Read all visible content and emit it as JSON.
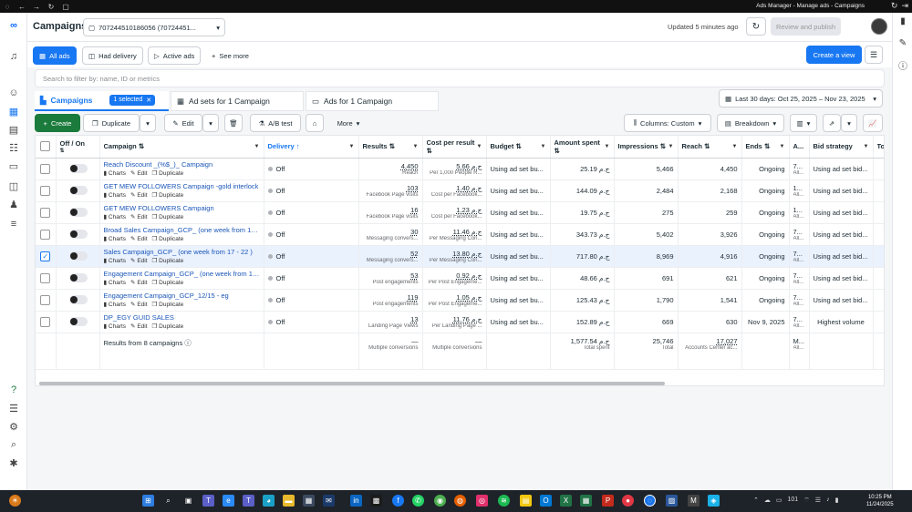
{
  "window": {
    "title": "Ads Manager - Manage ads - Campaigns"
  },
  "header": {
    "page_title": "Campaigns",
    "account": "707244510186056 (70724451...",
    "updated": "Updated 5 minutes ago",
    "review_label": "Review and publish"
  },
  "filters": {
    "all_ads": "All ads",
    "had_delivery": "Had delivery",
    "active_ads": "Active ads",
    "see_more": "See more",
    "create_view": "Create a view"
  },
  "search": {
    "placeholder": "Search to filter by: name, ID or metrics"
  },
  "tabs": {
    "campaigns": "Campaigns",
    "selected": "1 selected",
    "adsets": "Ad sets for 1 Campaign",
    "ads": "Ads for 1 Campaign"
  },
  "date_range": "Last 30 days: Oct 25, 2025 – Nov 23, 2025",
  "toolbar": {
    "create": "Create",
    "duplicate": "Duplicate",
    "edit": "Edit",
    "ab_test": "A/B test",
    "more": "More",
    "columns": "Columns: Custom",
    "breakdown": "Breakdown"
  },
  "table": {
    "headers": {
      "offon": "Off / On",
      "campaign": "Campaign",
      "delivery": "Delivery",
      "results": "Results",
      "cpr": "Cost per result",
      "budget": "Budget",
      "spent": "Amount spent",
      "impressions": "Impressions",
      "reach": "Reach",
      "ends": "Ends",
      "attr": "A...",
      "bid": "Bid strategy",
      "total": "Tota mes"
    },
    "row_actions": {
      "charts": "Charts",
      "edit": "Edit",
      "duplicate": "Duplicate"
    },
    "rows": [
      {
        "name": "Reach Discount _(%$_)_ Campaign",
        "delivery": "Off",
        "results": "4,450",
        "results_sub": "Reach",
        "cpr": "5.66 ج.م",
        "cpr_sub": "Per 1,000 People R...",
        "budget": "Using ad set bu...",
        "spent": "25.19 ج.م",
        "impressions": "5,466",
        "reach": "4,450",
        "ends": "Ongoing",
        "attr": "7...",
        "attr_sub": "All...",
        "bid": "Using ad set bid...",
        "checked": false
      },
      {
        "name": "GET MEW FOLLOWERS Campaign -gold interlock",
        "delivery": "Off",
        "results": "103",
        "results_sub": "Facebook Page visits",
        "cpr": "1.40 ج.م",
        "cpr_sub": "Cost per Facebook...",
        "budget": "Using ad set bu...",
        "spent": "144.09 ج.م",
        "impressions": "2,484",
        "reach": "2,168",
        "ends": "Ongoing",
        "attr": "1...",
        "attr_sub": "All...",
        "bid": "Using ad set bid...",
        "checked": false
      },
      {
        "name": "GET MEW FOLLOWERS Campaign",
        "delivery": "Off",
        "results": "16",
        "results_sub": "Facebook Page visits",
        "cpr": "1.23 ج.م",
        "cpr_sub": "Cost per Facebook...",
        "budget": "Using ad set bu...",
        "spent": "19.75 ج.م",
        "impressions": "275",
        "reach": "259",
        "ends": "Ongoing",
        "attr": "1...",
        "attr_sub": "All...",
        "bid": "Using ad set bid...",
        "checked": false
      },
      {
        "name": "Broad Sales Campaign_GCP_ (one week from 17 -...",
        "delivery": "Off",
        "results": "30",
        "results_sub": "Messaging convers...",
        "cpr": "11.46 ج.م",
        "cpr_sub": "Per Messaging Con...",
        "budget": "Using ad set bu...",
        "spent": "343.73 ج.م",
        "impressions": "5,402",
        "reach": "3,926",
        "ends": "Ongoing",
        "attr": "7...",
        "attr_sub": "All...",
        "bid": "Using ad set bid...",
        "checked": false
      },
      {
        "name": "Sales Campaign_GCP_ (one week from 17 - 22 )",
        "delivery": "Off",
        "results": "52",
        "results_sub": "Messaging convers...",
        "cpr": "13.80 ج.م",
        "cpr_sub": "Per Messaging Con...",
        "budget": "Using ad set bu...",
        "spent": "717.80 ج.م",
        "impressions": "8,969",
        "reach": "4,916",
        "ends": "Ongoing",
        "attr": "7...",
        "attr_sub": "All...",
        "bid": "Using ad set bid...",
        "checked": true
      },
      {
        "name": "Engagement Campaign_GCP_ (one week from 17...",
        "delivery": "Off",
        "results": "53",
        "results_sub": "Post engagements",
        "cpr": "0.92 ج.م",
        "cpr_sub": "Per Post Engageme...",
        "budget": "Using ad set bu...",
        "spent": "48.66 ج.م",
        "impressions": "691",
        "reach": "621",
        "ends": "Ongoing",
        "attr": "7...",
        "attr_sub": "All...",
        "bid": "Using ad set bid...",
        "checked": false
      },
      {
        "name": "Engagement Campaign_GCP_12/15 - eg",
        "delivery": "Off",
        "results": "119",
        "results_sub": "Post engagements",
        "cpr": "1.05 ج.م",
        "cpr_sub": "Per Post Engageme...",
        "budget": "Using ad set bu...",
        "spent": "125.43 ج.م",
        "impressions": "1,790",
        "reach": "1,541",
        "ends": "Ongoing",
        "attr": "7...",
        "attr_sub": "All...",
        "bid": "Using ad set bid...",
        "checked": false
      },
      {
        "name": "DP_EGY GUID SALES",
        "delivery": "Off",
        "results": "13",
        "results_sub": "Landing Page Views",
        "cpr": "11.76 ج.م",
        "cpr_sub": "Per Landing Page ...",
        "budget": "Using ad set bu...",
        "spent": "152.89 ج.م",
        "impressions": "669",
        "reach": "630",
        "ends": "Nov 9, 2025",
        "attr": "7...",
        "attr_sub": "All...",
        "bid": "Highest volume",
        "checked": false
      }
    ],
    "summary": {
      "label": "Results from 8 campaigns",
      "results": "—",
      "results_sub": "Multiple conversions",
      "cpr": "—",
      "cpr_sub": "Multiple conversions",
      "spent": "1,577.54 ج.م",
      "spent_sub": "Total spent",
      "impressions": "25,746",
      "impressions_sub": "Total",
      "reach": "17,027",
      "reach_sub": "Accounts Center ac...",
      "attr": "M...",
      "attr_sub": "All..."
    }
  },
  "clock": {
    "time": "10:25 PM",
    "date": "11/24/2025"
  },
  "tray": {
    "temp": "101"
  }
}
